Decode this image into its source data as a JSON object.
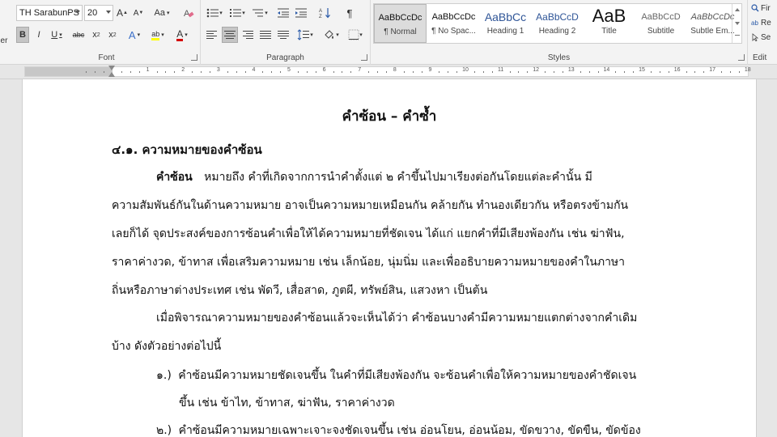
{
  "ribbon": {
    "font_group": {
      "label": "Font",
      "font_name": "TH SarabunPS",
      "font_size": "20",
      "grow_label": "A",
      "shrink_label": "A",
      "case_label": "Aa",
      "bold": "B",
      "italic": "I",
      "underline": "U",
      "strike": "abc",
      "subscript": "x",
      "superscript": "x",
      "text_effects": "A",
      "highlight": "ab",
      "font_color": "A",
      "colors": {
        "highlight": "#ffff00",
        "font_color": "#d40000"
      }
    },
    "paragraph_group": {
      "label": "Paragraph"
    },
    "styles_group": {
      "label": "Styles",
      "items": [
        {
          "preview": "AaBbCcDc",
          "name": "¶ Normal",
          "active": true
        },
        {
          "preview": "AaBbCcDc",
          "name": "¶ No Spac..."
        },
        {
          "preview": "AaBbCc",
          "name": "Heading 1"
        },
        {
          "preview": "AaBbCcD",
          "name": "Heading 2"
        },
        {
          "preview": "AaB",
          "name": "Title"
        },
        {
          "preview": "AaBbCcD",
          "name": "Subtitle"
        },
        {
          "preview": "AaBbCcDc",
          "name": "Subtle Em..."
        }
      ]
    },
    "left_edge": {
      "clip": "er"
    },
    "editing_group": {
      "label": "Edit",
      "find": "Fir",
      "replace": "Re",
      "select": "Se"
    }
  },
  "ruler": {
    "labels": [
      "1",
      "2",
      "3",
      "4",
      "5",
      "6",
      "7",
      "8",
      "9",
      "10",
      "11",
      "12",
      "13",
      "14",
      "15",
      "16",
      "17",
      "18"
    ]
  },
  "document": {
    "title": "คำซ้อน – คำซ้ำ",
    "heading": "๔.๑. ความหมายของคำซ้อน",
    "para1": {
      "lead": "คำซ้อน",
      "line1": "หมายถึง คำที่เกิดจากการนำคำตั้งแต่ ๒ คำขึ้นไปมาเรียงต่อกันโดยแต่ละคำนั้น มี",
      "line2": "ความสัมพันธ์กันในด้านความหมาย อาจเป็นความหมายเหมือนกัน คล้ายกัน ทำนองเดียวกัน หรือตรงข้ามกัน",
      "line3": "เลยก็ได้ จุดประสงค์ของการซ้อนคำเพื่อให้ได้ความหมายที่ชัดเจน ได้แก่ แยกคำที่มีเสียงพ้องกัน เช่น ฆ่าฟัน,",
      "line4": "ราคาค่างวด, ข้าทาส เพื่อเสริมความหมาย เช่น เล็กน้อย, นุ่มนิ่ม และเพื่ออธิบายความหมายของคำในภาษา",
      "line5": "ถิ่นหรือภาษาต่างประเทศ เช่น พัดวี, เสื่อสาด, ภูตผี, ทรัพย์สิน, แสวงหา เป็นต้น"
    },
    "para2": {
      "line1": "เมื่อพิจารณาความหมายของคำซ้อนแล้วจะเห็นได้ว่า คำซ้อนบางคำมีความหมายแตกต่างจากคำเดิม",
      "line2": "บ้าง ดังตัวอย่างต่อไปนี้"
    },
    "item1": {
      "marker": "๑.)",
      "line1": "คำซ้อนมีความหมายชัดเจนขึ้น ในคำที่มีเสียงพ้องกัน จะซ้อนคำเพื่อให้ความหมายของคำชัดเจน",
      "line2": "ขึ้น เช่น ข้าไท, ข้าทาส, ฆ่าฟัน, ราคาค่างวด"
    },
    "item2": {
      "marker": "๒.)",
      "line1": "คำซ้อนมีความหมายเฉพาะเจาะจงชัดเจนขึ้น เช่น อ่อนโยน, อ่อนน้อม, ขัดขวาง, ขัดขืน, ขัดข้อง"
    }
  }
}
